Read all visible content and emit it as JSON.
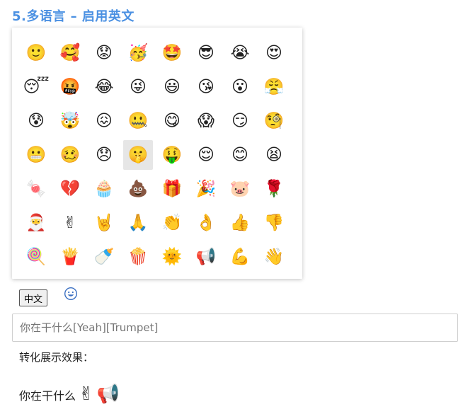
{
  "title": "5.多语言 – 启用英文",
  "emoji_grid": {
    "selected_index": 27,
    "cells": [
      {
        "name": "slightly-smiling-face",
        "glyph": "🙂"
      },
      {
        "name": "smiling-face-with-hearts",
        "glyph": "🥰"
      },
      {
        "name": "worried-face",
        "glyph": "😟"
      },
      {
        "name": "partying-face",
        "glyph": "🥳"
      },
      {
        "name": "star-struck",
        "glyph": "🤩"
      },
      {
        "name": "sunglasses-face",
        "glyph": "😎"
      },
      {
        "name": "loudly-crying-face",
        "glyph": "😭"
      },
      {
        "name": "heart-eyes-face",
        "glyph": "😍"
      },
      {
        "name": "sleeping-face",
        "glyph": "😴"
      },
      {
        "name": "cursing-face",
        "glyph": "🤬"
      },
      {
        "name": "tears-of-joy-face",
        "glyph": "😂"
      },
      {
        "name": "winking-tongue-face",
        "glyph": "😜"
      },
      {
        "name": "grinning-face",
        "glyph": "😃"
      },
      {
        "name": "face-blowing-kiss",
        "glyph": "😘"
      },
      {
        "name": "hushed-face",
        "glyph": "😮"
      },
      {
        "name": "steam-nose-face",
        "glyph": "😤"
      },
      {
        "name": "anxious-sweat-face",
        "glyph": "😰"
      },
      {
        "name": "exploding-head",
        "glyph": "🤯"
      },
      {
        "name": "confounded-face",
        "glyph": "😖"
      },
      {
        "name": "zipper-mouth-face",
        "glyph": "🤐"
      },
      {
        "name": "yum-face",
        "glyph": "😋"
      },
      {
        "name": "screaming-face",
        "glyph": "😱"
      },
      {
        "name": "smirking-face",
        "glyph": "😏"
      },
      {
        "name": "monocle-face",
        "glyph": "🧐"
      },
      {
        "name": "grimacing-face",
        "glyph": "😬"
      },
      {
        "name": "woozy-face",
        "glyph": "🥴"
      },
      {
        "name": "disappointed-face",
        "glyph": "😞"
      },
      {
        "name": "shushing-face",
        "glyph": "🤫"
      },
      {
        "name": "money-mouth-face",
        "glyph": "🤑"
      },
      {
        "name": "relieved-face",
        "glyph": "😌"
      },
      {
        "name": "smiling-blush-face",
        "glyph": "😊"
      },
      {
        "name": "tired-face",
        "glyph": "😫"
      },
      {
        "name": "candy-cane",
        "glyph": "🍬"
      },
      {
        "name": "broken-heart",
        "glyph": "💔"
      },
      {
        "name": "cupcake",
        "glyph": "🧁"
      },
      {
        "name": "pile-of-poo",
        "glyph": "💩"
      },
      {
        "name": "wrapped-gift",
        "glyph": "🎁"
      },
      {
        "name": "party-popper",
        "glyph": "🎉"
      },
      {
        "name": "pig-face",
        "glyph": "🐷"
      },
      {
        "name": "rose",
        "glyph": "🌹"
      },
      {
        "name": "santa",
        "glyph": "🎅"
      },
      {
        "name": "victory-hand",
        "glyph": "✌"
      },
      {
        "name": "rock-on-hand",
        "glyph": "🤘"
      },
      {
        "name": "folded-hands",
        "glyph": "🙏"
      },
      {
        "name": "clapping-hands",
        "glyph": "👏"
      },
      {
        "name": "ok-hand",
        "glyph": "👌"
      },
      {
        "name": "thumbs-up",
        "glyph": "👍"
      },
      {
        "name": "thumbs-down",
        "glyph": "👎"
      },
      {
        "name": "lollipop",
        "glyph": "🍭"
      },
      {
        "name": "french-fries",
        "glyph": "🍟"
      },
      {
        "name": "baby-bottle",
        "glyph": "🍼"
      },
      {
        "name": "popcorn",
        "glyph": "🍿"
      },
      {
        "name": "sun-with-face",
        "glyph": "🌞"
      },
      {
        "name": "megaphone",
        "glyph": "📢"
      },
      {
        "name": "flexed-biceps",
        "glyph": "💪"
      },
      {
        "name": "waving-hand",
        "glyph": "👋"
      }
    ]
  },
  "language_button": "中文",
  "emoji_toggle_icon": "smiling-face-icon",
  "input": {
    "placeholder": "你在干什么[Yeah][Trumpet]"
  },
  "result": {
    "label": "转化展示效果：",
    "text": "你在干什么",
    "emojis": [
      "✌",
      "📢"
    ]
  },
  "colors": {
    "title": "#4a90e2",
    "selected_cell": "#e6e6e6"
  }
}
